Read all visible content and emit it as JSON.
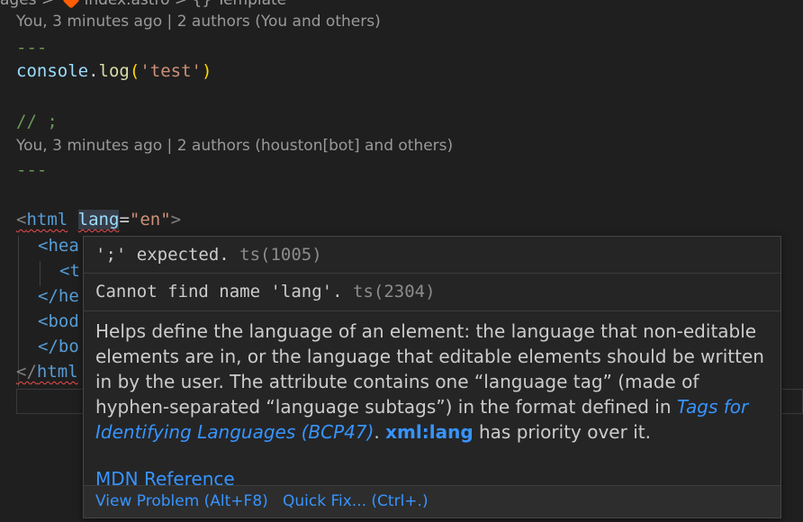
{
  "breadcrumb": {
    "prefix": "ages",
    "sep1": ">",
    "file": "index.astro",
    "sep2": ">",
    "symbol": "{} Template"
  },
  "codelens": [
    "You, 3 minutes ago | 2 authors (You and others)",
    "You, 3 minutes ago | 2 authors (houston[bot] and others)"
  ],
  "code": {
    "dashes": "---",
    "console_obj": "console",
    "dot": ".",
    "log_fn": "log",
    "open_paren": "(",
    "log_arg": "'test'",
    "close_paren": ")",
    "comment": "// ;",
    "html_open": "<",
    "html_tag": "html",
    "attr_name": "lang",
    "attr_eq": "=",
    "attr_value": "\"en\"",
    "html_close": ">",
    "head_open": "<hea",
    "title_open": "<t",
    "head_close": "</he",
    "body_open": "<bod",
    "body_close": "</bo",
    "html_end_open": "</",
    "html_end_tag": "html"
  },
  "hover": {
    "diagnostic_1": {
      "message": "';' expected.",
      "code": "ts(1005)"
    },
    "diagnostic_2": {
      "message": "Cannot find name 'lang'.",
      "code": "ts(2304)"
    },
    "doc": {
      "part1": "Helps define the language of an element: the language that non-editable elements are in, or the language that editable elements should be written in by the user. The attribute contains one “language tag” (made of hyphen-separated “language subtags”) in the format defined in ",
      "link": "Tags for Identifying Languages (BCP47)",
      "part2": ". ",
      "bold": "xml:lang",
      "part3": " has priority over it."
    },
    "mdn_link": "MDN Reference",
    "actions": {
      "view_problem": "View Problem (Alt+F8)",
      "quick_fix": "Quick Fix... (Ctrl+.)"
    }
  }
}
